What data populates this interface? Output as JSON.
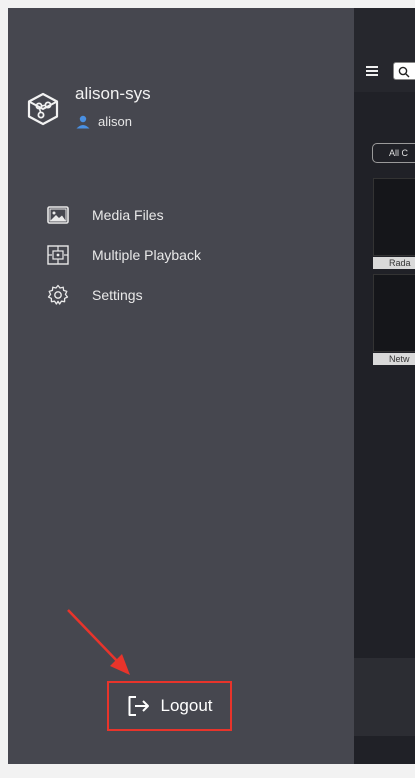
{
  "profile": {
    "system_name": "alison-sys",
    "username": "alison",
    "logo_icon": "cube-network-icon",
    "user_icon": "user-icon"
  },
  "menu": {
    "items": [
      {
        "label": "Media Files",
        "icon": "image-icon"
      },
      {
        "label": "Multiple Playback",
        "icon": "multi-view-icon"
      },
      {
        "label": "Settings",
        "icon": "gear-icon"
      }
    ]
  },
  "logout": {
    "label": "Logout",
    "icon": "logout-icon",
    "highlight_color": "#e8342b"
  },
  "background": {
    "filter_label": "All C",
    "device_labels": [
      "Rada",
      "Netw"
    ]
  },
  "colors": {
    "drawer_bg": "#46474f",
    "content_bg": "#202127",
    "accent_user": "#4a90e2"
  }
}
